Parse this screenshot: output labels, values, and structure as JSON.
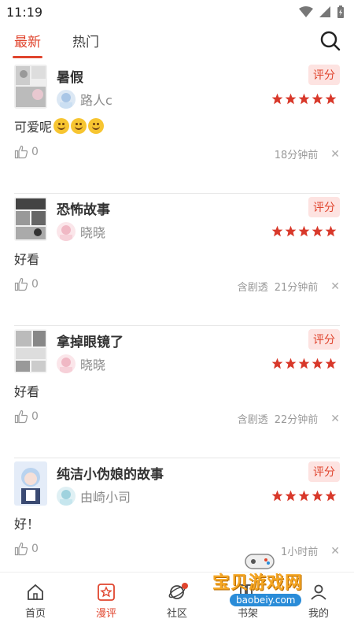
{
  "status": {
    "time": "11:19"
  },
  "tabs": [
    {
      "label": "最新",
      "active": true
    },
    {
      "label": "热门",
      "active": false
    }
  ],
  "reviews": [
    {
      "title": "暑假",
      "rate_label": "评分",
      "user": "路人c",
      "stars": 5,
      "comment": "可爱呢",
      "emoji_count": 3,
      "likes": "0",
      "spoiler": "",
      "time": "18分钟前"
    },
    {
      "title": "恐怖故事",
      "rate_label": "评分",
      "user": "晓晓",
      "stars": 5,
      "comment": "好看",
      "emoji_count": 0,
      "likes": "0",
      "spoiler": "含剧透",
      "time": "21分钟前"
    },
    {
      "title": "拿掉眼镜了",
      "rate_label": "评分",
      "user": "晓晓",
      "stars": 5,
      "comment": "好看",
      "emoji_count": 0,
      "likes": "0",
      "spoiler": "含剧透",
      "time": "22分钟前"
    },
    {
      "title": "纯洁小伪娘的故事",
      "rate_label": "评分",
      "user": "由崎小司",
      "stars": 5,
      "comment": "好！",
      "emoji_count": 0,
      "likes": "0",
      "spoiler": "",
      "time": "1小时前"
    }
  ],
  "nav": [
    {
      "label": "首页",
      "icon": "home-icon",
      "active": false
    },
    {
      "label": "漫评",
      "icon": "review-star-icon",
      "active": true
    },
    {
      "label": "社区",
      "icon": "planet-icon",
      "active": false,
      "dot": true
    },
    {
      "label": "书架",
      "icon": "bookshelf-icon",
      "active": false
    },
    {
      "label": "我的",
      "icon": "user-icon",
      "active": false
    }
  ],
  "watermark": {
    "text": "宝贝游戏网",
    "url": "baobeiy.com"
  },
  "colors": {
    "accent": "#e0452e",
    "star": "#d8382a",
    "badge_bg": "#fde3e1"
  }
}
